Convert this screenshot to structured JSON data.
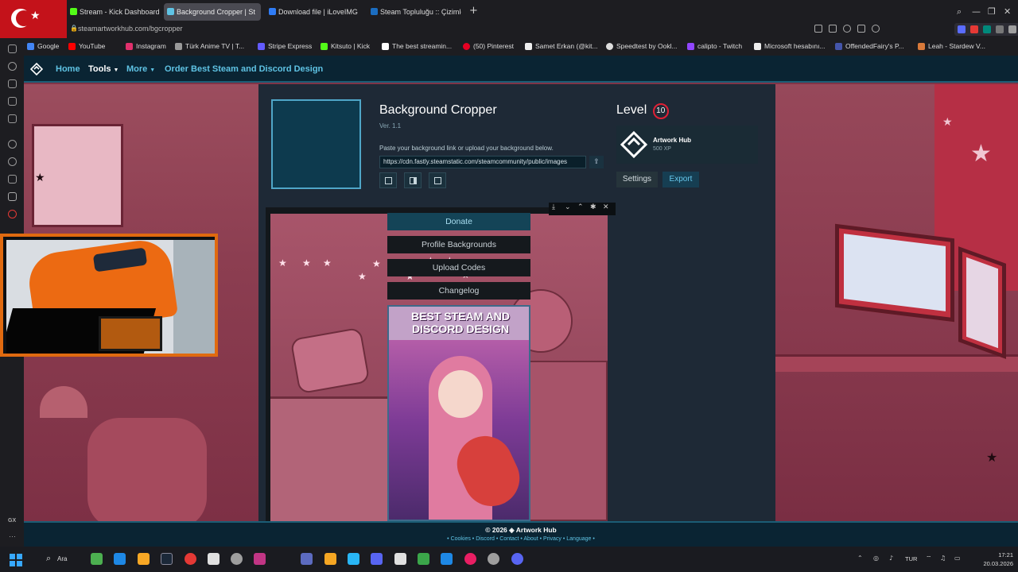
{
  "browser": {
    "tabs": [
      {
        "label": "Stream - Kick Dashboard",
        "color": "#53fc18"
      },
      {
        "label": "Background Cropper | St",
        "color": "#5fc3e4",
        "active": true
      },
      {
        "label": "Download file | iLoveIMG",
        "color": "#2f7cf6"
      },
      {
        "label": "Steam Topluluğu :: Çizimle",
        "color": "#1b6dc1"
      }
    ],
    "new_tab": "+",
    "address": "steamartworkhub.com/bgcropper",
    "extension_label": "AI",
    "window_controls": [
      "⌕",
      "—",
      "❐",
      "✕"
    ],
    "bookmarks": [
      {
        "label": "Google",
        "color": "#4285f4"
      },
      {
        "label": "YouTube",
        "color": "#ff0000"
      },
      {
        "label": "Instagram",
        "color": "#e1306c"
      },
      {
        "label": "Türk Anime TV | T...",
        "color": "#999999"
      },
      {
        "label": "Stripe Express",
        "color": "#635bff"
      },
      {
        "label": "Kitsuto | Kick",
        "color": "#53fc18"
      },
      {
        "label": "The best streamin...",
        "color": "#ffffff"
      },
      {
        "label": "(50) Pinterest",
        "color": "#e60023"
      },
      {
        "label": "Samet Erkan (@kit...",
        "color": "#eeeeee"
      },
      {
        "label": "Speedtest by Ookl...",
        "color": "#dddddd"
      },
      {
        "label": "calipto - Twitch",
        "color": "#9146ff"
      },
      {
        "label": "Microsoft hesabını...",
        "color": "#eeeeee"
      },
      {
        "label": "OffendedFairy's P...",
        "color": "#4455aa"
      },
      {
        "label": "Leah - Stardew V...",
        "color": "#d97a3a"
      }
    ],
    "sidebar_gx": "GX",
    "sidebar_more": "···"
  },
  "site": {
    "nav": {
      "home": "Home",
      "tools": "Tools",
      "more": "More",
      "order": "Order Best Steam and Discord Design",
      "caret": "▼"
    },
    "tool": {
      "title": "Background Cropper",
      "version": "Ver. 1.1",
      "hint": "Paste your background link or upload your background below.",
      "url_value": "https://cdn.fastly.steamstatic.com/steamcommunity/public/images",
      "upload_icon": "⇪"
    },
    "profile": {
      "level_label": "Level",
      "level_value": "10",
      "name": "Artwork Hub",
      "xp": "500 XP",
      "settings": "Settings",
      "export": "Export"
    },
    "preview_controls": [
      "⤓",
      "⌄",
      "⌃",
      "✱",
      "✕"
    ],
    "sidebar_buttons": {
      "donate": "Donate",
      "profile_backgrounds": "Profile Backgrounds",
      "upload_codes": "Upload Codes",
      "changelog": "Changelog"
    },
    "ad": {
      "line1": "BEST STEAM AND",
      "line2": "DISCORD DESIGN"
    },
    "footer": {
      "copyright": "© 2026",
      "brand": "Artwork Hub",
      "links": "• Cookies • Discord • Contact • About • Privacy • Language •"
    }
  },
  "taskbar": {
    "search": "Ara",
    "language": "TUR",
    "time": "17:21",
    "date": "20.03.2026",
    "apps": [
      "#4caf50",
      "#1e88e5",
      "#f9a825",
      "#1b2838",
      "#e53935",
      "#e0e0e0",
      "#9e9e9e",
      "#c13584",
      "#5c6bc0",
      "#f5a623",
      "#29b6f6",
      "#5865f2",
      "#e0e0e0",
      "#3ba64a",
      "#1e88e5",
      "#e91e63",
      "#9e9e9e",
      "#5865f2"
    ]
  }
}
